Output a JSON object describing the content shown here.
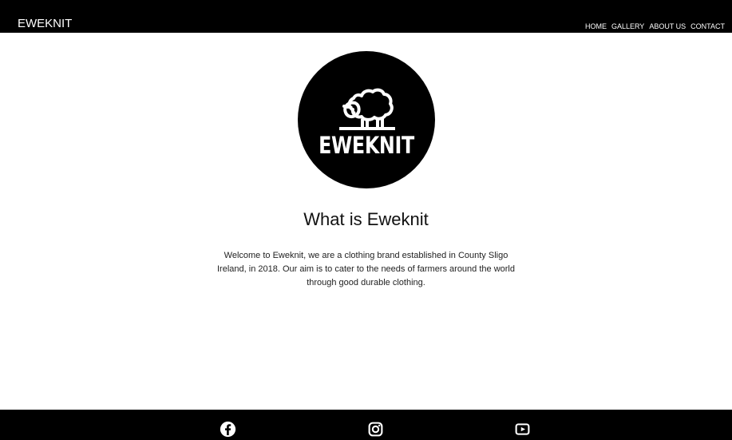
{
  "brand": {
    "name": "EWEKNIT"
  },
  "navigation": {
    "items": [
      {
        "label": "HOME"
      },
      {
        "label": "GALLERY"
      },
      {
        "label": "ABOUT US"
      },
      {
        "label": "CONTACT"
      }
    ]
  },
  "hero": {
    "logo_text": "EWEKNIT",
    "logo_icon": "sheep-icon",
    "headline": "What is Eweknit",
    "intro": "Welcome to Eweknit, we are a clothing brand established in County Sligo Ireland, in 2018. Our aim is to cater to the needs of farmers around the world through good durable clothing."
  },
  "footer": {
    "social_links": [
      {
        "icon": "facebook-icon"
      },
      {
        "icon": "instagram-icon"
      },
      {
        "icon": "youtube-icon"
      }
    ]
  },
  "colors": {
    "header_background": "#000000",
    "footer_background": "#000000",
    "page_background": "#ffffff",
    "text_dark": "#111111",
    "text_light": "#ffffff"
  }
}
